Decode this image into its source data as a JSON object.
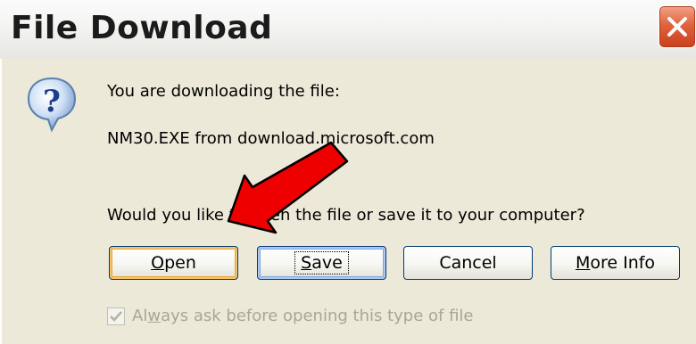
{
  "window": {
    "title": "File Download",
    "close_icon": "close-icon",
    "close_color": "#d9532f"
  },
  "message": {
    "line1": "You are downloading the file:",
    "file": "NM30.EXE from download.microsoft.com",
    "question": "Would you like to open the file or save it to your computer?",
    "icon": "question-icon"
  },
  "buttons": {
    "open_prefix": "",
    "open_access": "O",
    "open_rest": "pen",
    "save_prefix": "",
    "save_access": "S",
    "save_rest": "ave",
    "cancel": "Cancel",
    "more_info_prefix": "",
    "more_info_access": "M",
    "more_info_rest": "ore Info"
  },
  "checkbox": {
    "checked": true,
    "label_prefix": "Al",
    "label_access": "w",
    "label_rest": "ays ask before opening this type of file"
  },
  "annotation": {
    "icon": "red-arrow-icon",
    "color": "#ee0000"
  }
}
